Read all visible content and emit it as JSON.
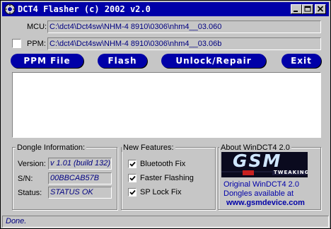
{
  "window": {
    "title": "DCT4 Flasher (c) 2002 v2.0",
    "minimize_icon": "minimize-icon",
    "maximize_icon": "maximize-icon",
    "close_icon": "close-icon"
  },
  "files": {
    "mcu_label": "MCU:",
    "mcu_path": "C:\\dct4\\Dct4sw\\NHM-4 8910\\0306\\nhm4__03.060",
    "ppm_label": "PPM:",
    "ppm_checked": false,
    "ppm_path": "C:\\dct4\\Dct4sw\\NHM-4 8910\\0306\\nhm4__03.06b"
  },
  "buttons": {
    "ppm_file": "PPM File",
    "flash": "Flash",
    "unlock_repair": "Unlock/Repair",
    "exit": "Exit"
  },
  "dongle": {
    "title": "Dongle Information:",
    "version_label": "Version:",
    "version_value": "v 1.01 (build 132)",
    "sn_label": "S/N:",
    "sn_value": "00BBCAB57B",
    "status_label": "Status:",
    "status_value": "STATUS OK"
  },
  "features": {
    "title": "New Features:",
    "items": [
      {
        "label": "Bluetooth Fix",
        "checked": true
      },
      {
        "label": "Faster Flashing",
        "checked": true
      },
      {
        "label": "SP Lock Fix",
        "checked": true
      }
    ]
  },
  "about": {
    "title": "About WinDCT4 2.0",
    "logo_text": "GSM",
    "logo_subtext": "TWEAKING",
    "line1": "Original WinDCT4 2.0",
    "line2": "Dongles available at",
    "url": "www.gsmdevice.com"
  },
  "status_bar": {
    "text": "Done."
  },
  "colors": {
    "titlebar": "#0000a8",
    "button": "#0000a8",
    "face": "#c6c6c6",
    "field_text": "#000080"
  }
}
